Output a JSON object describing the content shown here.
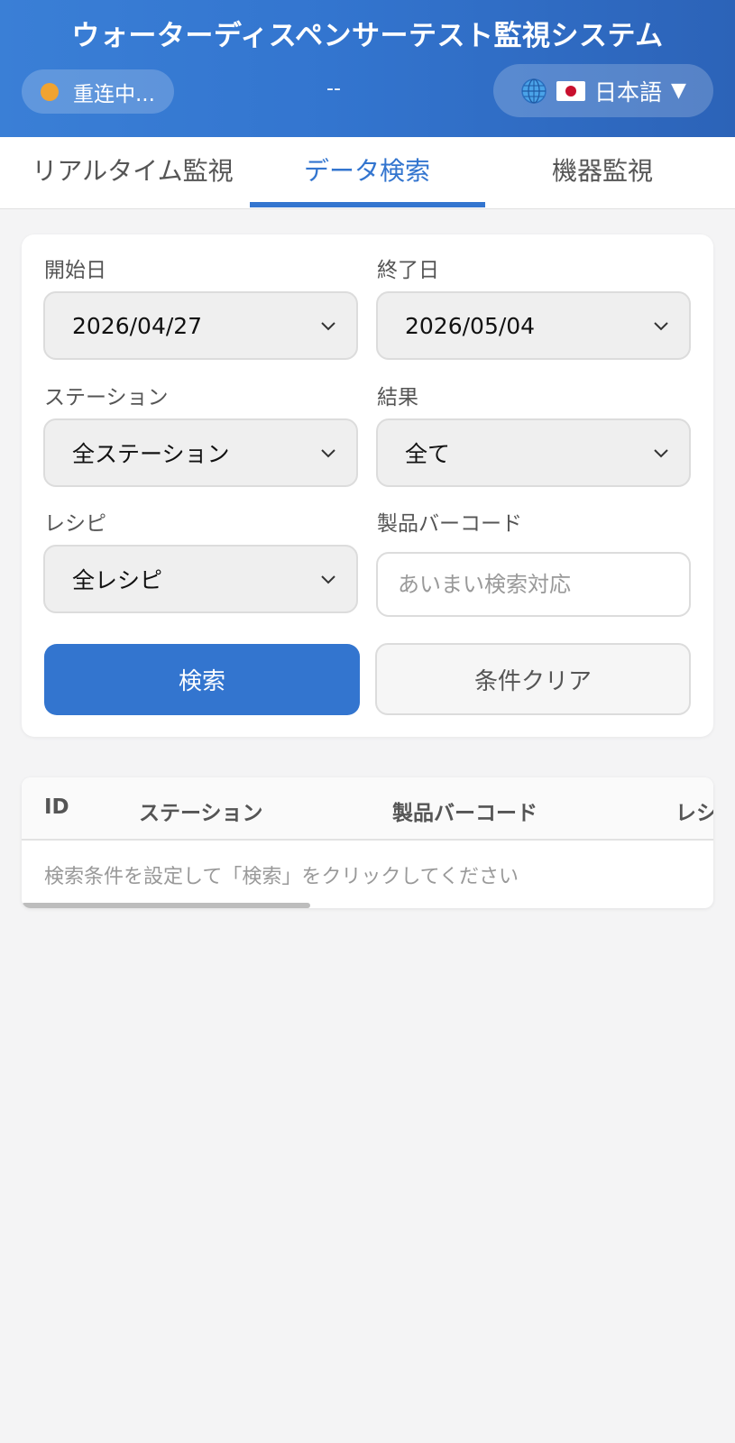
{
  "header": {
    "title": "ウォーターディスペンサーテスト監視システム",
    "status": "重连中...",
    "time": "--",
    "language": "日本語",
    "status_color": "#f0a330",
    "accent": "#3375cf"
  },
  "tabs": [
    {
      "label": "リアルタイム監視",
      "active": false
    },
    {
      "label": "データ検索",
      "active": true
    },
    {
      "label": "機器監視",
      "active": false
    }
  ],
  "filters": {
    "start_date": {
      "label": "開始日",
      "value": "2026/04/27"
    },
    "end_date": {
      "label": "終了日",
      "value": "2026/05/04"
    },
    "station": {
      "label": "ステーション",
      "value": "全ステーション"
    },
    "result": {
      "label": "結果",
      "value": "全て"
    },
    "recipe": {
      "label": "レシピ",
      "value": "全レシピ"
    },
    "barcode": {
      "label": "製品バーコード",
      "placeholder": "あいまい検索対応",
      "value": ""
    },
    "search_label": "検索",
    "clear_label": "条件クリア"
  },
  "table": {
    "columns": [
      "ID",
      "ステーション",
      "製品バーコード",
      "レシ"
    ],
    "empty_message": "検索条件を設定して「検索」をクリックしてください"
  }
}
